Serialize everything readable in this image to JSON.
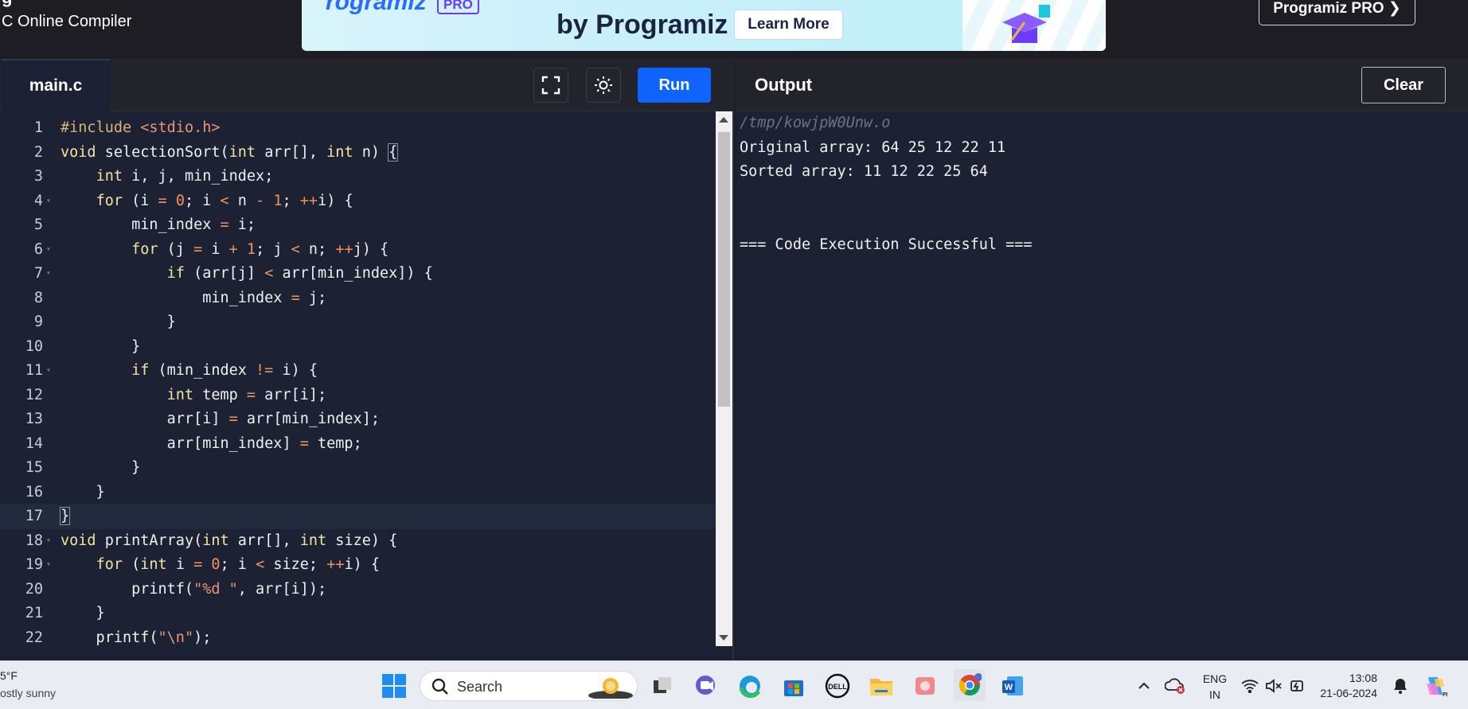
{
  "top": {
    "brand_cut": "g",
    "subtitle": "C Online Compiler",
    "ad_logo": "rogramiz",
    "ad_pro_badge": "PRO",
    "ad_by": "by Programiz",
    "ad_learn_more": "Learn More",
    "pro_button": "Programiz PRO ❯"
  },
  "editor": {
    "tab": "main.c",
    "run_label": "Run",
    "lines": [
      {
        "n": "1",
        "html": "<span class='pp'>#include </span><span class='str'>&lt;stdio.h&gt;</span>"
      },
      {
        "n": "2",
        "html": "<span class='kw'>void</span> selectionSort(<span class='kw'>int</span> arr[], <span class='kw'>int</span> n) <span style='outline:1px solid #8a8f9e'>{</span>"
      },
      {
        "n": "3",
        "html": "    <span class='kw'>int</span> i, j, min_index;"
      },
      {
        "n": "4",
        "html": "    <span class='kw'>for</span> (i <span class='op'>=</span> <span class='num'>0</span>; i <span class='op'>&lt;</span> n <span class='op'>-</span> <span class='num'>1</span>; <span class='op'>++</span>i) {",
        "fold": true
      },
      {
        "n": "5",
        "html": "        min_index <span class='op'>=</span> i;"
      },
      {
        "n": "6",
        "html": "        <span class='kw'>for</span> (j <span class='op'>=</span> i <span class='op'>+</span> <span class='num'>1</span>; j <span class='op'>&lt;</span> n; <span class='op'>++</span>j) {",
        "fold": true
      },
      {
        "n": "7",
        "html": "            <span class='kw'>if</span> (arr[j] <span class='op'>&lt;</span> arr[min_index]) {",
        "fold": true
      },
      {
        "n": "8",
        "html": "                min_index <span class='op'>=</span> j;"
      },
      {
        "n": "9",
        "html": "            }"
      },
      {
        "n": "10",
        "html": "        }"
      },
      {
        "n": "11",
        "html": "        <span class='kw'>if</span> (min_index <span class='op'>!=</span> i) {",
        "fold": true
      },
      {
        "n": "12",
        "html": "            <span class='kw'>int</span> temp <span class='op'>=</span> arr[i];"
      },
      {
        "n": "13",
        "html": "            arr[i] <span class='op'>=</span> arr[min_index];"
      },
      {
        "n": "14",
        "html": "            arr[min_index] <span class='op'>=</span> temp;"
      },
      {
        "n": "15",
        "html": "        }"
      },
      {
        "n": "16",
        "html": "    }"
      },
      {
        "n": "17",
        "html": "<span style='outline:1px solid #8a8f9e'>}</span>",
        "active": true
      },
      {
        "n": "18",
        "html": "<span class='kw'>void</span> printArray(<span class='kw'>int</span> arr[], <span class='kw'>int</span> size) {",
        "fold": true
      },
      {
        "n": "19",
        "html": "    <span class='kw'>for</span> (<span class='kw'>int</span> i <span class='op'>=</span> <span class='num'>0</span>; i <span class='op'>&lt;</span> size; <span class='op'>++</span>i) {",
        "fold": true
      },
      {
        "n": "20",
        "html": "        printf(<span class='str'>\"%d \"</span>, arr[i]);"
      },
      {
        "n": "21",
        "html": "    }"
      },
      {
        "n": "22",
        "html": "    printf(<span class='str'>\"\\n\"</span>);"
      }
    ]
  },
  "output": {
    "title": "Output",
    "clear_label": "Clear",
    "lines": [
      {
        "text": "/tmp/kowjpW0Unw.o",
        "path": true
      },
      {
        "text": "Original array: 64 25 12 22 11"
      },
      {
        "text": "Sorted array: 11 12 22 25 64"
      },
      {
        "text": ""
      },
      {
        "text": ""
      },
      {
        "text": "=== Code Execution Successful ==="
      }
    ]
  },
  "taskbar": {
    "weather_temp": "5°F",
    "weather_desc": "ostly sunny",
    "search_placeholder": "Search",
    "lang_top": "ENG",
    "lang_bottom": "IN",
    "time": "13:08",
    "date": "21-06-2024"
  },
  "colors": {
    "accent_run": "#0f63ff",
    "editor_bg": "#1c2233",
    "keyword": "#f3e3a2",
    "string": "#e8957a"
  }
}
